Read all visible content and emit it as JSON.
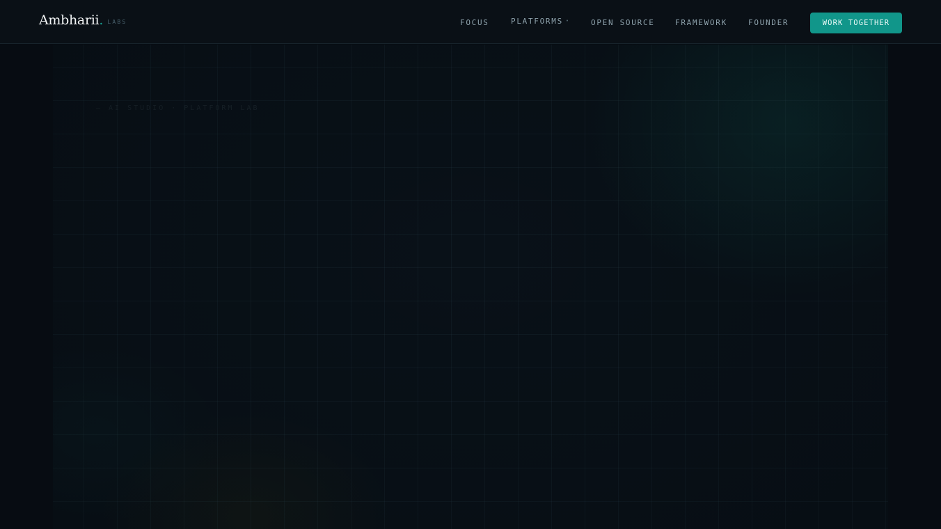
{
  "brand": {
    "name": "Ambharii",
    "dot": ".",
    "sub": "LABS"
  },
  "nav": {
    "items": [
      {
        "label": "FOCUS"
      },
      {
        "label": "PLATFORMS",
        "has_dropdown": true
      },
      {
        "label": "OPEN SOURCE"
      },
      {
        "label": "FRAMEWORK"
      },
      {
        "label": "FOUNDER"
      }
    ],
    "cta_label": "WORK TOGETHER"
  },
  "hero": {
    "eyebrow": "— AI STUDIO · PLATFORM LAB"
  },
  "colors": {
    "background": "#070c12",
    "accent": "#11968a",
    "nav_text": "#8ea2ac"
  }
}
